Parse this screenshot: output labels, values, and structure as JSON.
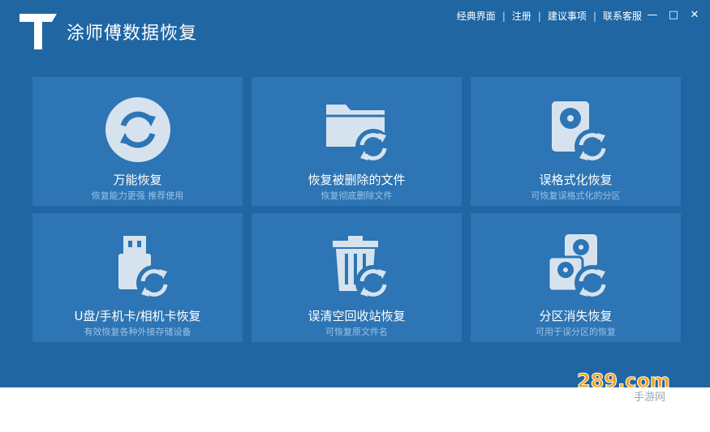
{
  "app": {
    "title": "涂师傅数据恢复"
  },
  "topmenu": {
    "items": [
      "经典界面",
      "注册",
      "建议事项",
      "联系客服"
    ],
    "separator": "|"
  },
  "window_controls": {
    "minimize": "—",
    "maximize": "□",
    "close": "✕"
  },
  "cards": [
    {
      "title": "万能恢复",
      "subtitle": "恢复能力更强 推荐使用",
      "icon": "universal-recovery-icon"
    },
    {
      "title": "恢复被删除的文件",
      "subtitle": "恢复彻底删除文件",
      "icon": "deleted-files-recovery-icon"
    },
    {
      "title": "误格式化恢复",
      "subtitle": "可恢复误格式化的分区",
      "icon": "format-recovery-icon"
    },
    {
      "title": "U盘/手机卡/相机卡恢复",
      "subtitle": "有效恢复各种外接存储设备",
      "icon": "usb-recovery-icon"
    },
    {
      "title": "误清空回收站恢复",
      "subtitle": "可恢复原文件名",
      "icon": "recycle-bin-recovery-icon"
    },
    {
      "title": "分区消失恢复",
      "subtitle": "可用于误分区的恢复",
      "icon": "partition-recovery-icon"
    }
  ],
  "colors": {
    "window_bg": "#1f66a3",
    "card_bg": "#2d75b4",
    "subtitle": "#9cc3e6",
    "icon": "#d6e3ef"
  },
  "watermark": {
    "text": "289.com",
    "subtext": "手游网"
  }
}
